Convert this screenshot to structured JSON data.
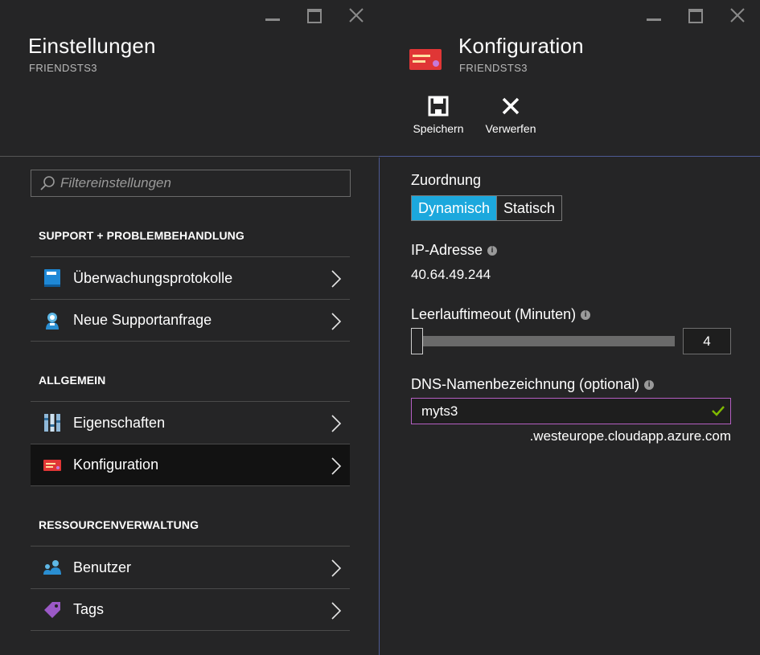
{
  "left_blade": {
    "title": "Einstellungen",
    "subtitle": "FRIENDSTS3",
    "filter_placeholder": "Filtereinstellungen",
    "sections": [
      {
        "header": "SUPPORT + PROBLEMBEHANDLUNG",
        "items": [
          {
            "label": "Überwachungsprotokolle",
            "icon": "book-icon"
          },
          {
            "label": "Neue Supportanfrage",
            "icon": "support-person-icon"
          }
        ]
      },
      {
        "header": "ALLGEMEIN",
        "items": [
          {
            "label": "Eigenschaften",
            "icon": "properties-bars-icon"
          },
          {
            "label": "Konfiguration",
            "icon": "ip-card-icon",
            "active": true
          }
        ]
      },
      {
        "header": "RESSOURCENVERWALTUNG",
        "items": [
          {
            "label": "Benutzer",
            "icon": "users-icon"
          },
          {
            "label": "Tags",
            "icon": "tag-icon"
          }
        ]
      }
    ]
  },
  "right_blade": {
    "title": "Konfiguration",
    "subtitle": "FRIENDSTS3",
    "commands": {
      "save": "Speichern",
      "discard": "Verwerfen"
    },
    "assignment": {
      "label": "Zuordnung",
      "options": [
        "Dynamisch",
        "Statisch"
      ],
      "selected": "Dynamisch"
    },
    "ip_address": {
      "label": "IP-Adresse",
      "value": "40.64.49.244"
    },
    "idle_timeout": {
      "label": "Leerlauftimeout (Minuten)",
      "value": "4"
    },
    "dns": {
      "label": "DNS-Namenbezeichnung (optional)",
      "value": "myts3",
      "suffix": ".westeurope.cloudapp.azure.com"
    }
  },
  "colors": {
    "accent": "#1ca8dd",
    "valid_check": "#7fba00",
    "dns_border": "#b55fc3",
    "active_item_bg": "#121212"
  }
}
